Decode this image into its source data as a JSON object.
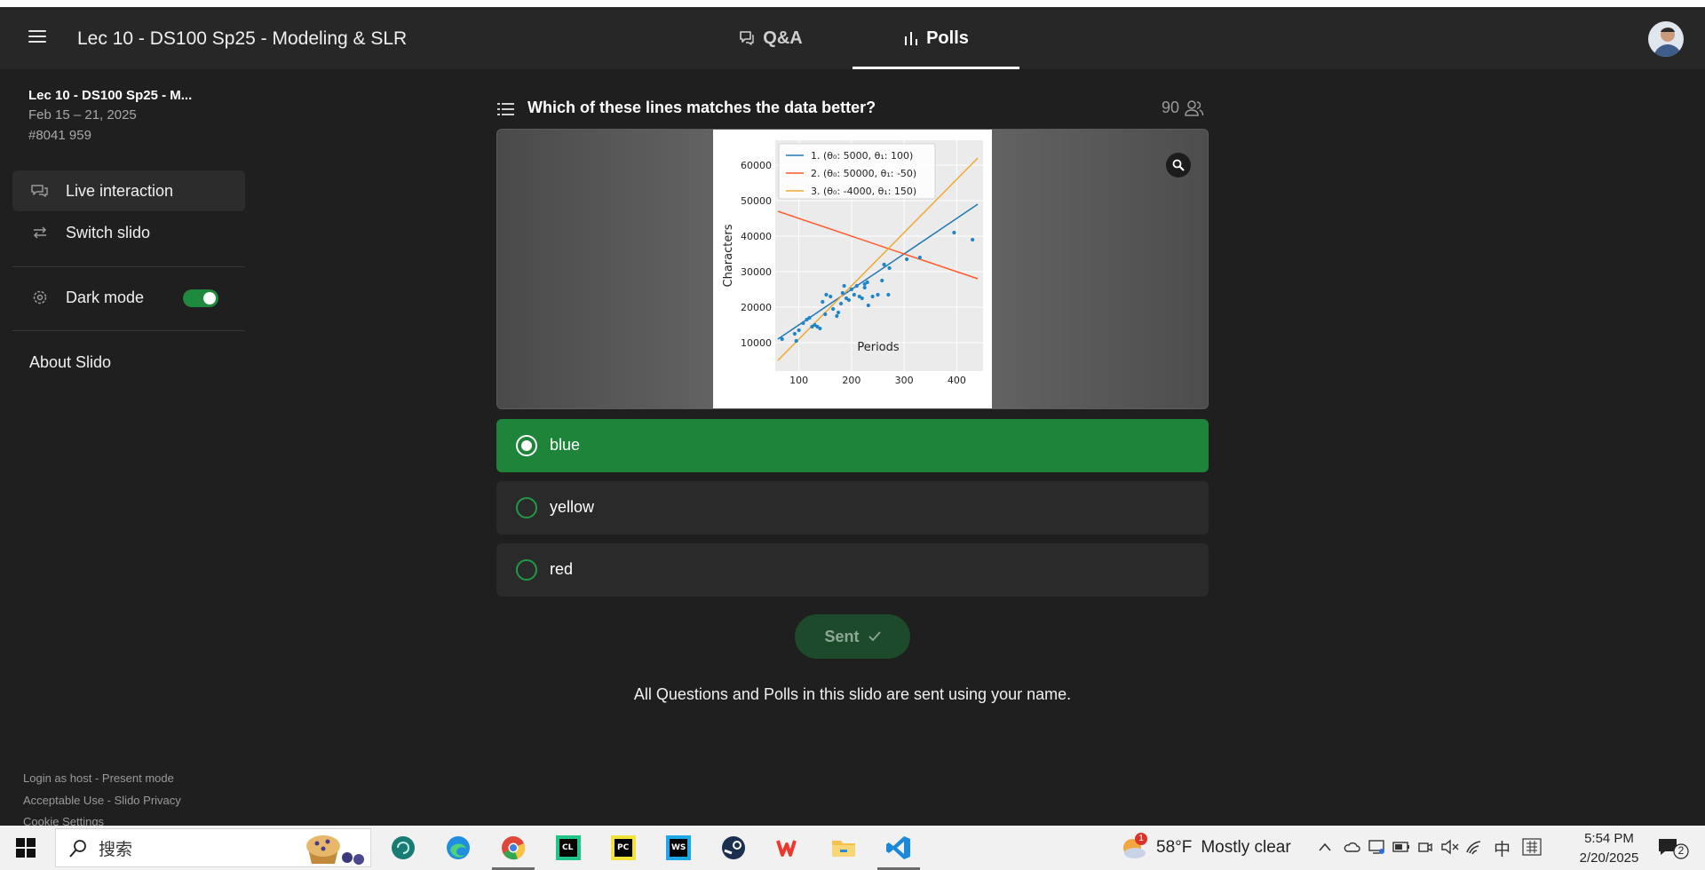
{
  "header": {
    "event_title": "Lec 10 - DS100 Sp25 - Modeling & SLR",
    "tabs": [
      {
        "label": "Q&A"
      },
      {
        "label": "Polls",
        "active": true
      }
    ]
  },
  "sidebar": {
    "event_name": "Lec 10 - DS100 Sp25 - M...",
    "dates": "Feb 15 – 21, 2025",
    "code": "#8041 959",
    "items": [
      {
        "label": "Live interaction"
      },
      {
        "label": "Switch slido"
      },
      {
        "label": "Dark mode"
      }
    ],
    "dark_mode_on": true,
    "about": "About Slido",
    "footer": {
      "login_host": "Login as host",
      "present_mode": "Present mode",
      "acceptable_use": "Acceptable Use",
      "privacy": "Slido Privacy",
      "cookie": "Cookie Settings",
      "separator": " - "
    }
  },
  "poll": {
    "question": "Which of these lines matches the data better?",
    "voters": "90",
    "options": [
      {
        "label": "blue",
        "selected": true
      },
      {
        "label": "yellow",
        "selected": false
      },
      {
        "label": "red",
        "selected": false
      }
    ],
    "sent_label": "Sent",
    "name_note": "All Questions and Polls in this slido are sent using your name."
  },
  "chart_data": {
    "type": "scatter",
    "xlabel": "Periods",
    "ylabel": "Characters",
    "xlim": [
      55,
      450
    ],
    "ylim": [
      2000,
      67000
    ],
    "xticks": [
      100,
      200,
      300,
      400
    ],
    "yticks": [
      10000,
      20000,
      30000,
      40000,
      50000,
      60000
    ],
    "grid": true,
    "legend": "top-left",
    "points": [
      [
        68,
        11000
      ],
      [
        92,
        12500
      ],
      [
        95,
        10500
      ],
      [
        100,
        13500
      ],
      [
        108,
        15500
      ],
      [
        115,
        16500
      ],
      [
        120,
        17000
      ],
      [
        125,
        14500
      ],
      [
        130,
        15000
      ],
      [
        135,
        14500
      ],
      [
        140,
        14000
      ],
      [
        150,
        18000
      ],
      [
        145,
        21500
      ],
      [
        152,
        23500
      ],
      [
        160,
        23000
      ],
      [
        165,
        19500
      ],
      [
        172,
        17500
      ],
      [
        175,
        18500
      ],
      [
        180,
        21000
      ],
      [
        183,
        24000
      ],
      [
        186,
        26000
      ],
      [
        190,
        22500
      ],
      [
        195,
        22000
      ],
      [
        200,
        25000
      ],
      [
        205,
        23500
      ],
      [
        210,
        26000
      ],
      [
        215,
        23000
      ],
      [
        220,
        22500
      ],
      [
        225,
        25500
      ],
      [
        230,
        27000
      ],
      [
        232,
        20500
      ],
      [
        240,
        23000
      ],
      [
        250,
        23500
      ],
      [
        258,
        27500
      ],
      [
        262,
        32000
      ],
      [
        270,
        23500
      ],
      [
        272,
        31000
      ],
      [
        305,
        33500
      ],
      [
        330,
        34000
      ],
      [
        395,
        41000
      ],
      [
        430,
        39000
      ],
      [
        225,
        26500
      ]
    ],
    "lines": [
      {
        "name": "1. (θ₀: 5000, θ₁: 100)",
        "theta0": 5000,
        "theta1": 100,
        "color": "#1f77b4"
      },
      {
        "name": "2. (θ₀: 50000, θ₁: -50)",
        "theta0": 50000,
        "theta1": -50,
        "color": "#ff5a2a"
      },
      {
        "name": "3. (θ₀: -4000, θ₁: 150)",
        "theta0": -4000,
        "theta1": 150,
        "color": "#f0a830"
      }
    ],
    "point_color": "#1f86c8"
  },
  "taskbar": {
    "search_placeholder": "搜索",
    "weather_temp": "58°F",
    "weather_desc": "Mostly clear",
    "weather_alert": "1",
    "ime": "中",
    "time": "5:54 PM",
    "date": "2/20/2025",
    "notification_count": "2"
  }
}
